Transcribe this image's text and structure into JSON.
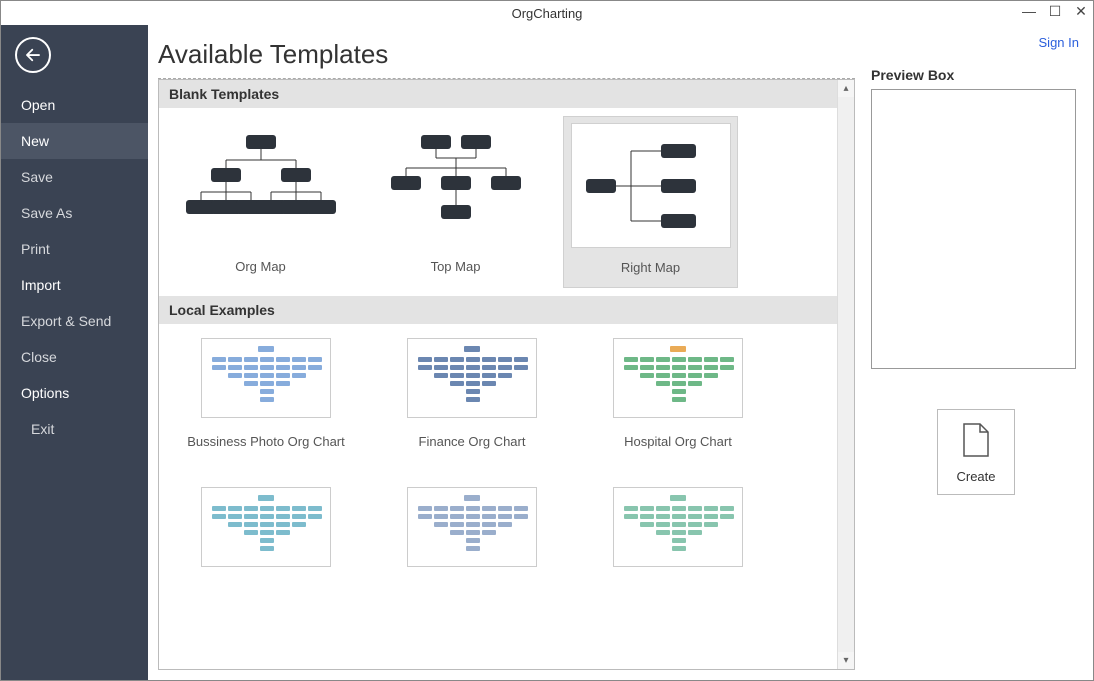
{
  "app_title": "OrgCharting",
  "signin_label": "Sign In",
  "sidebar": {
    "items": [
      {
        "label": "Open",
        "bold": true
      },
      {
        "label": "New",
        "bold": true,
        "active": true
      },
      {
        "label": "Save"
      },
      {
        "label": "Save As"
      },
      {
        "label": "Print"
      },
      {
        "label": "Import",
        "bold": true
      },
      {
        "label": "Export & Send"
      },
      {
        "label": "Close"
      },
      {
        "label": "Options",
        "bold": true
      },
      {
        "label": "Exit",
        "exit": true
      }
    ]
  },
  "main_heading": "Available Templates",
  "sections": {
    "blank": {
      "title": "Blank Templates",
      "items": [
        {
          "label": "Org Map"
        },
        {
          "label": "Top Map"
        },
        {
          "label": "Right Map",
          "selected": true
        }
      ]
    },
    "local": {
      "title": "Local Examples",
      "items": [
        {
          "label": "Bussiness Photo Org Chart",
          "scheme": "#7aa3d8"
        },
        {
          "label": "Finance Org Chart",
          "scheme": "#5b7aa8"
        },
        {
          "label": "Hospital Org Chart",
          "scheme": "#5eb07a",
          "accent": "#e8a245"
        },
        {
          "label": "",
          "scheme": "#6fb5c8"
        },
        {
          "label": "",
          "scheme": "#8fa5c7"
        },
        {
          "label": "",
          "scheme": "#7bbfa5"
        }
      ]
    }
  },
  "preview": {
    "title": "Preview Box"
  },
  "create_label": "Create",
  "icons": {
    "back": "arrow-left-circle",
    "file": "file"
  }
}
